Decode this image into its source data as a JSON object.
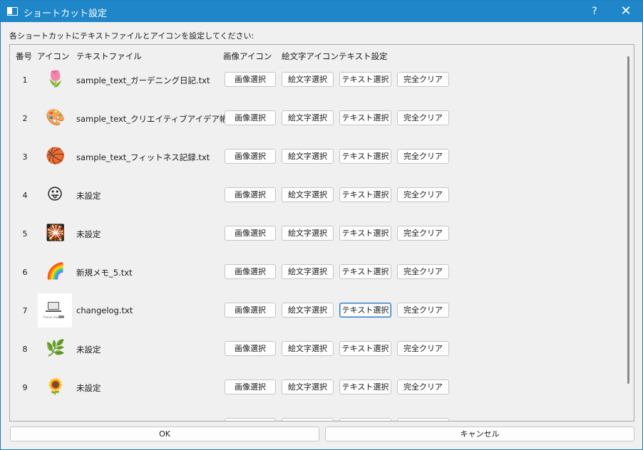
{
  "window": {
    "title": "ショートカット設定",
    "help_label": "?",
    "close_label": "✕"
  },
  "instruction": "各ショートカットにテキストファイルとアイコンを設定してください:",
  "columns": {
    "number": "番号",
    "icon": "アイコン",
    "text_file": "テキストファイル",
    "image_icon": "画像アイコン",
    "emoji_icon": "絵文字アイコン",
    "text_setting": "テキスト設定"
  },
  "buttons": {
    "select_image": "画像選択",
    "select_emoji": "絵文字選択",
    "select_text": "テキスト選択",
    "clear_all": "完全クリア"
  },
  "rows": [
    {
      "number": "1",
      "icon": "🌷",
      "icon_name": "tulip-icon",
      "file": "sample_text_ガーデニング日記.txt"
    },
    {
      "number": "2",
      "icon": "🎨",
      "icon_name": "palette-icon",
      "file": "sample_text_クリエイティブアイデア帳.txt"
    },
    {
      "number": "3",
      "icon": "🏀",
      "icon_name": "basketball-icon",
      "file": "sample_text_フィットネス記録.txt"
    },
    {
      "number": "4",
      "icon": "😛",
      "icon_name": "tongue-face-icon",
      "file": "未設定"
    },
    {
      "number": "5",
      "icon": "🎇",
      "icon_name": "sparkler-icon",
      "file": "未設定"
    },
    {
      "number": "6",
      "icon": "🌈",
      "icon_name": "rainbow-icon",
      "file": "新規メモ_5.txt"
    },
    {
      "number": "7",
      "icon": "",
      "icon_name": "laptop-thumbnail",
      "thumb_caption": "Focus mode",
      "file": "changelog.txt"
    },
    {
      "number": "8",
      "icon": "🌿",
      "icon_name": "herb-icon",
      "file": "未設定"
    },
    {
      "number": "9",
      "icon": "🌻",
      "icon_name": "sunflower-icon",
      "file": "未設定"
    }
  ],
  "footer": {
    "ok_label": "OK",
    "cancel_label": "キャンセル"
  }
}
